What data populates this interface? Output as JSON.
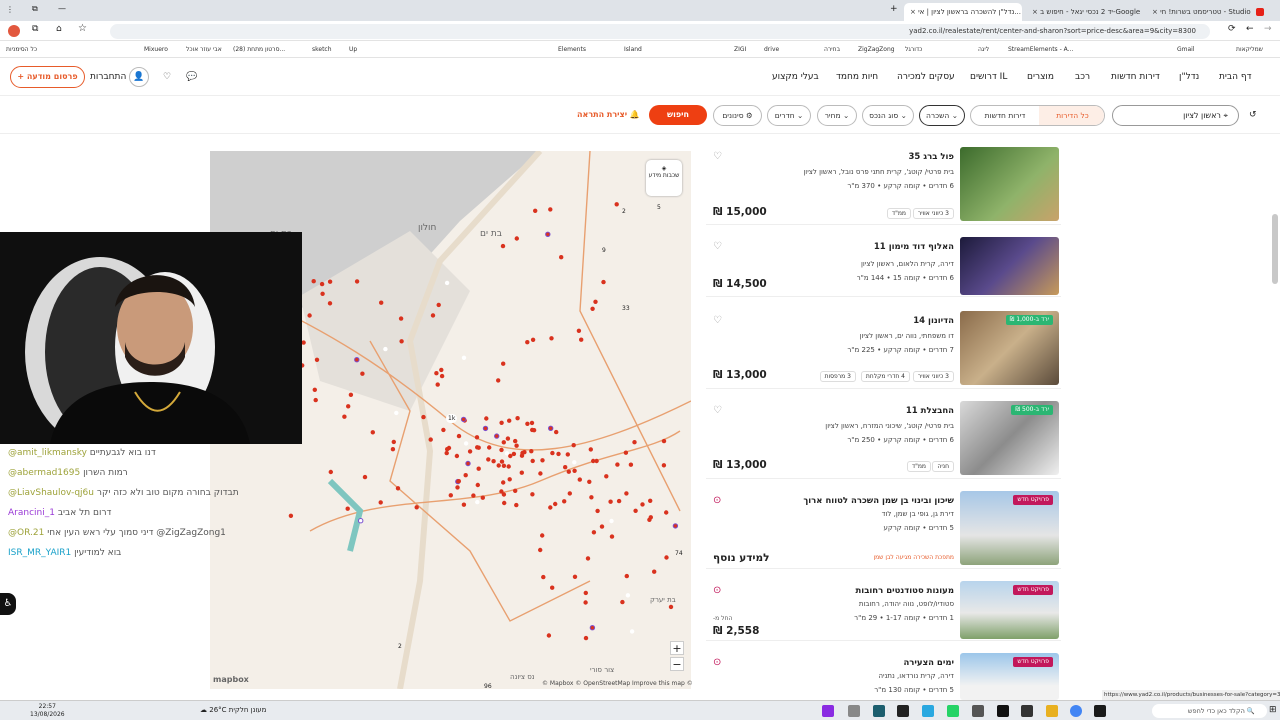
{
  "browser": {
    "tabs": [
      {
        "label": "טטריסמט בשרות! חי - Studio"
      },
      {
        "label": "יד 2 נכסי יגאל - חיפוש ב-Google"
      },
      {
        "label": "נדל\"ן להשכרה בראשון לציון | אי..."
      }
    ],
    "url": "yad2.co.il/realestate/rent/center-and-sharon?sort=price-desc&area=9&city=8300",
    "bookmarks": [
      "שמליקאות",
      "Gmail",
      "StreamElements - A...",
      "ליגה",
      "בחירה",
      "כדורגל",
      "ZigZagZong",
      "drive",
      "ZIGI",
      "Elements",
      "Island",
      "Mixuero",
      "אבי עוזר אוכל",
      "sketch",
      "Up",
      "(28) סרטון מתחת...",
      "כל הסימניות"
    ],
    "status_url": "https://www.yad2.co.il/products/businesses-for-sale?category=37"
  },
  "site": {
    "nav": [
      "דף הבית",
      "נדל\"ן",
      "דירות חדשות",
      "רכב",
      "מוצרים",
      "דרושים IL",
      "עסקים למכירה",
      "חיות מחמד",
      "בעלי מקצוע"
    ],
    "connect_label": "התחברות",
    "publish_label": "+ פרסום מודעה"
  },
  "filters": {
    "city_value": "ראשון לציון",
    "all_apartments": "כל הדירות",
    "new_apartments": "דירות חדשות",
    "rent": "השכרה",
    "property_type": "סוג הנכס",
    "price": "מחיר",
    "rooms": "חדרים",
    "more_filters": "סינונים",
    "search": "חיפוש",
    "create_alert": "יצירת התראה"
  },
  "map": {
    "labels": [
      "בת ים",
      "חולון",
      "בת-ים",
      "בת יערק",
      "כנסת",
      "צור סורי",
      "נס ציונה"
    ],
    "cluster_numbers": [
      "2",
      "5",
      "9",
      "33",
      "1k",
      "74",
      "2",
      "96"
    ],
    "layers_label": "שכבות מידע",
    "zoom_in": "+",
    "zoom_out": "−",
    "attribution": "© Mapbox © OpenStreetMap  Improve this map ©",
    "logo": "mapbox"
  },
  "listings": [
    {
      "title": "פול ברג 35",
      "type": "בית פרטי/ קוטג', קרית חתני פרס נובל, ראשון לציון",
      "details": "6 חדרים • קומה קרקע • 370 מ\"ר",
      "price": "15,000 ₪",
      "tags": [
        "3 כיווני אוויר",
        "ממ\"ד"
      ],
      "badge": ""
    },
    {
      "title": "האלוף דוד מימון 11",
      "type": "דירה, קרית הלאום, ראשון לציון",
      "details": "6 חדרים • קומה 15 • 144 מ\"ר",
      "price": "14,500 ₪",
      "tags": [],
      "badge": ""
    },
    {
      "title": "הדיונון 14",
      "type": "דו משפחתי, נווה ים, ראשון לציון",
      "details": "7 חדרים • קומה קרקע • 225 מ\"ר",
      "price": "13,000 ₪",
      "tags": [
        "3 כיווני אוויר",
        "4 חדרי מקלחת",
        "3 מרפסות"
      ],
      "badge": "ירד ב-1,000 ₪"
    },
    {
      "title": "החבצלת 11",
      "type": "בית פרטי/ קוטג', שיכוני המזרח, ראשון לציון",
      "details": "6 חדרים • קומה קרקע • 250 מ\"ר",
      "price": "13,000 ₪",
      "tags": [
        "חניה",
        "ממ\"ד"
      ],
      "badge": "ירד ב-500 ₪"
    },
    {
      "title": "שיכון ובינוי בן שמן השכרה לטווח ארוך",
      "type": "דירת גן, גופי בן שמן, לוד",
      "details": "5 חדרים • קומה קרקע",
      "price": "למידע נוסף",
      "tags": [
        "מתפכת השכירה מגיעה לבן שמן"
      ],
      "badge": "פרויקט חדש"
    },
    {
      "title": "מעונות סטודנטים רחובות",
      "type": "סטודיו/לופט, נווה יהודה, רחובות",
      "details": "1 חדרים • קומה 1-17 • 29 מ\"ר",
      "price": "2,558 ₪",
      "price_prefix": "החל מ-",
      "tags": [],
      "badge": "פרויקט חדש"
    },
    {
      "title": "ימים הצעירה",
      "type": "דירה, קרית נורדאו, נתניה",
      "details": "5 חדרים • קומה 130 מ\"ר",
      "price": "",
      "tags": [],
      "badge": "פרויקט חדש"
    }
  ],
  "chat": [
    {
      "user": "@amit_likmansky",
      "text": "דנו בוא לגבעתיים",
      "color": "#9ea33b"
    },
    {
      "user": "@abermad1695",
      "text": "רמות השרון",
      "color": "#9ea33b"
    },
    {
      "user": "@LiavShaulov-qj6u",
      "text": "תבדוק בחורה מקום טוב ולא כזה יקר",
      "color": "#9ea33b"
    },
    {
      "user": "Arancini_1",
      "text": "דרום תל אביב",
      "color": "#9a3bd6"
    },
    {
      "user": "@OR.21",
      "text": "דיני סמוך עלי ראש העין אחי @ZigZagZong1",
      "color": "#9ea33b"
    },
    {
      "user": "ISR_MR_YAIR1",
      "text": "בוא למודיעין",
      "color": "#1aa1c9"
    }
  ],
  "taskbar": {
    "weather": "26°C  מעונן חלקית",
    "time": "22:57",
    "date": "13/08/2026",
    "search_placeholder": "הקלד כאן כדי לחפש"
  },
  "colors": {
    "accent": "#ee3f12",
    "map_bg": "#f4efe8",
    "map_dot": "#d9321e",
    "sea": "#c9c9c9",
    "road": "#e8a070"
  }
}
